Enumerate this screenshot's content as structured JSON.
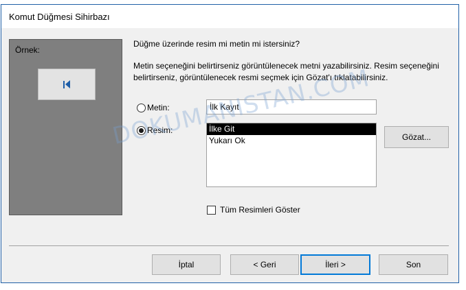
{
  "window": {
    "title": "Komut Düğmesi Sihirbazı"
  },
  "preview": {
    "label": "Örnek:",
    "icon": "first-record-icon"
  },
  "question": "Düğme üzerinde resim mi metin mi istersiniz?",
  "description": "Metin seçeneğini belirtirseniz görüntülenecek metni yazabilirsiniz. Resim seçeneğini belirtirseniz, görüntülenecek resmi seçmek için Gözat'ı tıklatabilirsiniz.",
  "options": {
    "text": {
      "label": "Metin:",
      "checked": false,
      "value": "İlk Kayıt"
    },
    "image": {
      "label": "Resim:",
      "checked": true
    }
  },
  "image_list": [
    "İlke Git",
    "Yukarı Ok"
  ],
  "browse_label": "Gözat...",
  "show_all": {
    "label": "Tüm Resimleri Göster",
    "checked": false
  },
  "footer": {
    "cancel": "İptal",
    "back": "< Geri",
    "next": "İleri >",
    "finish": "Son"
  },
  "watermark": "DOKUMANISTAN.COM",
  "colors": {
    "accent": "#0078d7",
    "preview_bg": "#7f7f7f",
    "icon": "#1e5ea8"
  }
}
